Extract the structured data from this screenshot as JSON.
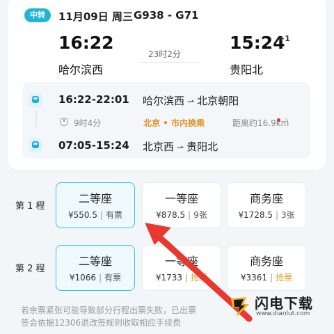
{
  "header": {
    "badge": "中转",
    "date": "11月09日 周三",
    "train_numbers": "G938 - G71"
  },
  "trip": {
    "departure_time": "16:22",
    "departure_station": "哈尔滨西",
    "arrival_time": "15:24",
    "arrival_day_offset": "+1",
    "arrival_station": "贵阳北",
    "duration": "23时2分"
  },
  "segments": [
    {
      "time": "16:22-22:01",
      "from": "哈尔滨西",
      "to": "北京朝阳"
    },
    {
      "time": "07:05-15:24",
      "from": "北京西",
      "to": "贵阳北"
    }
  ],
  "transfer": {
    "wait": "9时4分",
    "label": "北京 • 市内换乘",
    "distance": "距离约16.9km"
  },
  "legs": [
    {
      "label": "第 1 程",
      "seats": [
        {
          "name": "二等座",
          "price": "¥550.5",
          "status": "有票",
          "selected": true
        },
        {
          "name": "一等座",
          "price": "¥878.5",
          "status": "9张",
          "selected": false
        },
        {
          "name": "商务座",
          "price": "¥1728.5",
          "status": "3张",
          "selected": false
        }
      ]
    },
    {
      "label": "第 2 程",
      "seats": [
        {
          "name": "二等座",
          "price": "¥1066",
          "status": "有票",
          "selected": true
        },
        {
          "name": "一等座",
          "price": "¥1733",
          "status": "抢票",
          "selected": false
        },
        {
          "name": "商务座",
          "price": "¥3361",
          "status": "抢票",
          "selected": false
        }
      ]
    }
  ],
  "notice": {
    "line1": "若余票紧张可能导致部分行程出票失败，已出票",
    "line2": "签会依据12306退改签规则收取相应手续费"
  },
  "watermark": {
    "name": "闪电下载",
    "url": "www.dianlut.com"
  },
  "colors": {
    "accent": "#1fb6d6",
    "transfer": "#e2912a",
    "grab_ticket": "#e39a1d",
    "annotation_arrow": "#e8382f"
  }
}
